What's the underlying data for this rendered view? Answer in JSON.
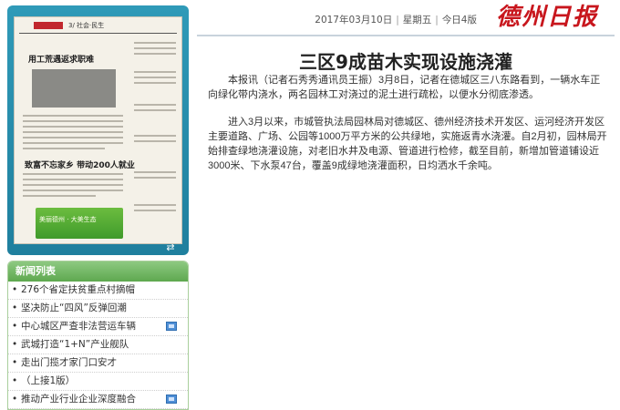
{
  "header": {
    "date": "2017年03月10日",
    "weekday": "星期五",
    "edition": "今日4版",
    "logo_text": "德州日报"
  },
  "paper_preview": {
    "page_label": "3/ 社会·民生",
    "headline_1": "用工荒遇返求职难",
    "headline_2": "致富不忘家乡 带动200人就业",
    "ad_text": "美丽德州 · 大美生态"
  },
  "news": {
    "title": "新闻列表",
    "items": [
      {
        "label": "276个省定扶贫重点村摘帽",
        "video": false
      },
      {
        "label": "坚决防止“四风”反弹回潮",
        "video": false
      },
      {
        "label": "中心城区严查非法营运车辆",
        "video": true
      },
      {
        "label": "武城打造“1+N”产业舰队",
        "video": false
      },
      {
        "label": "走出门揽才家门口安才",
        "video": false
      },
      {
        "label": "（上接1版）",
        "video": false
      },
      {
        "label": "推动产业行业企业深度融合",
        "video": true
      }
    ]
  },
  "article": {
    "title": "三区9成苗木实现设施浇灌",
    "paragraphs": [
      "本报讯（记者石秀秀通讯员王振）3月8日，记者在德城区三八东路看到，一辆水车正向绿化带内浇水，两名园林工对浇过的泥土进行疏松，以便水分彻底渗透。",
      "进入3月以来，市城管执法局园林局对德城区、德州经济技术开发区、运河经济开发区主要道路、广场、公园等1000万平方米的公共绿地，实施返青水浇灌。自2月初，园林局开始排查绿地浇灌设施，对老旧水井及电源、管道进行检修，截至目前，新增加管道铺设近3000米、下水泵47台，覆盖9成绿地浇灌面积，日均洒水千余吨。"
    ]
  }
}
